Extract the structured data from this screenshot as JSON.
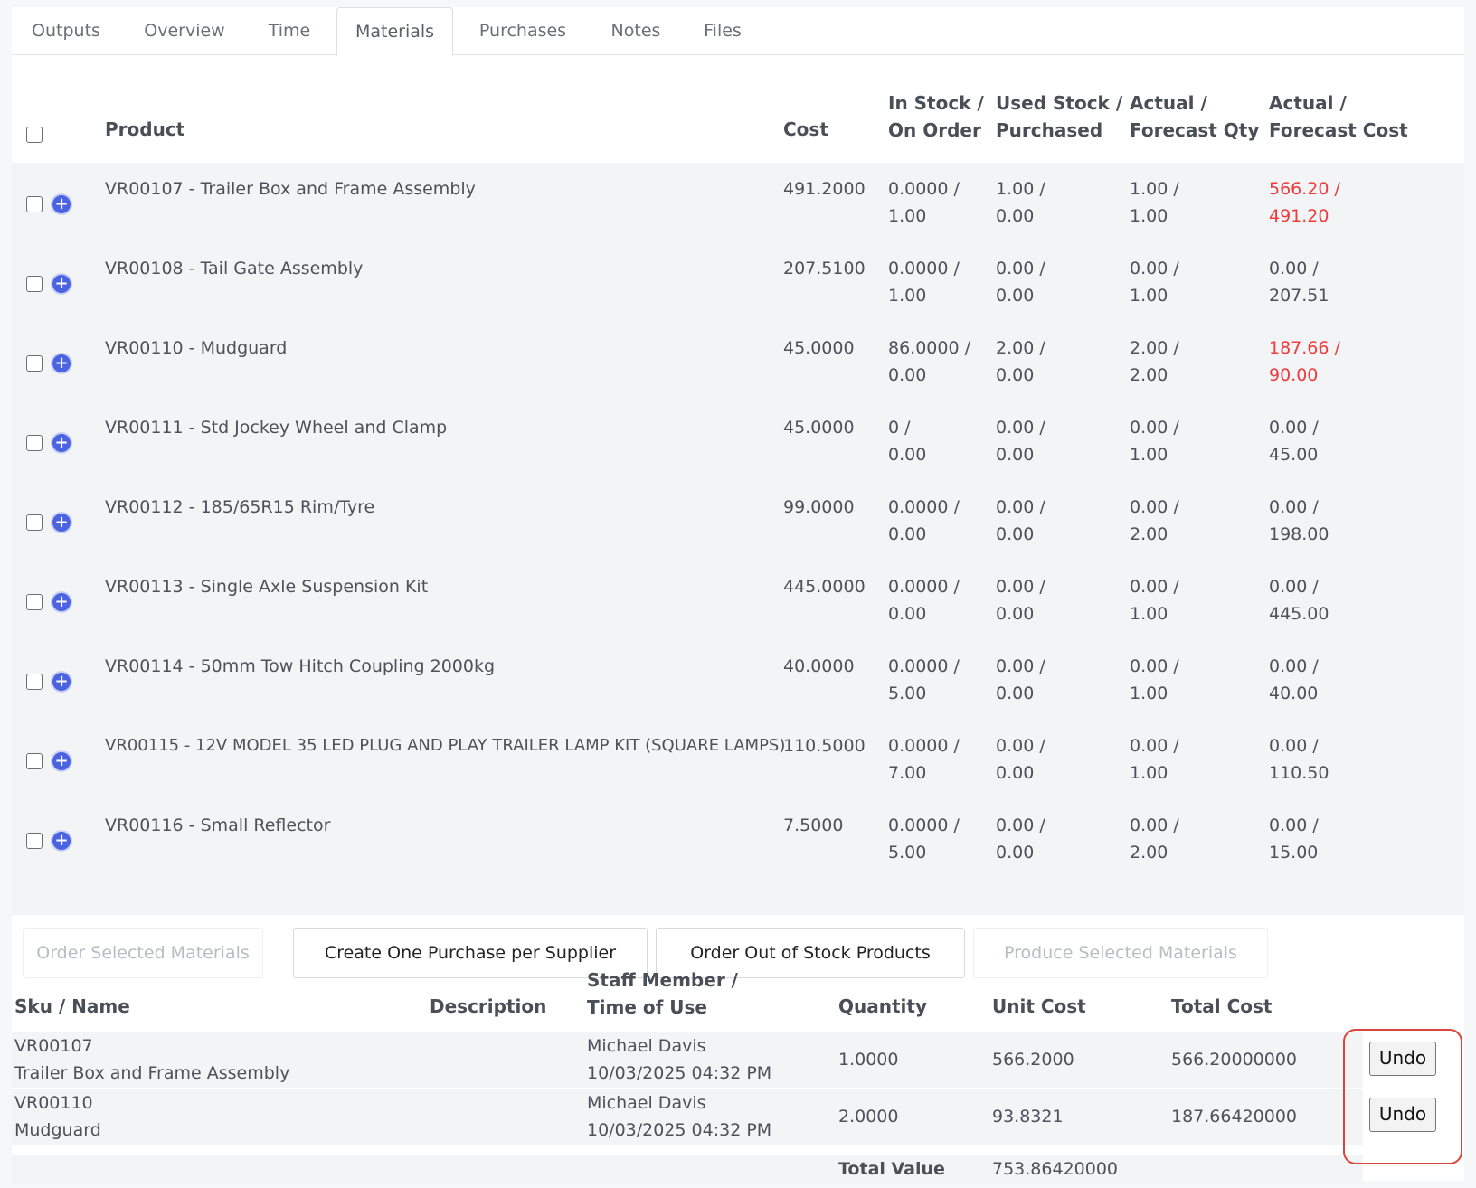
{
  "tabs": [
    {
      "label": "Outputs"
    },
    {
      "label": "Overview"
    },
    {
      "label": "Time"
    },
    {
      "label": "Materials",
      "active": true
    },
    {
      "label": "Purchases"
    },
    {
      "label": "Notes"
    },
    {
      "label": "Files"
    }
  ],
  "materials": {
    "headers": {
      "product": "Product",
      "cost": "Cost",
      "in_stock_1": "In Stock /",
      "in_stock_2": "On Order",
      "used_1": "Used Stock /",
      "used_2": "Purchased",
      "actual_qty_1": "Actual /",
      "actual_qty_2": "Forecast Qty",
      "actual_cost_1": "Actual /",
      "actual_cost_2": "Forecast Cost"
    },
    "rows": [
      {
        "product": "VR00107 - Trailer Box and Frame Assembly",
        "cost": "491.2000",
        "stock": "0.0000 /",
        "order": "1.00",
        "used": "1.00 /",
        "purchased": "0.00",
        "aqty": "1.00 /",
        "fqty": "1.00",
        "acost": "566.20 /",
        "fcost": "491.20",
        "over": true
      },
      {
        "product": "VR00108 - Tail Gate Assembly",
        "cost": "207.5100",
        "stock": "0.0000 /",
        "order": "1.00",
        "used": "0.00 /",
        "purchased": "0.00",
        "aqty": "0.00 /",
        "fqty": "1.00",
        "acost": "0.00 /",
        "fcost": "207.51",
        "over": false
      },
      {
        "product": "VR00110 - Mudguard",
        "cost": "45.0000",
        "stock": "86.0000 /",
        "order": "0.00",
        "used": "2.00 /",
        "purchased": "0.00",
        "aqty": "2.00 /",
        "fqty": "2.00",
        "acost": "187.66 /",
        "fcost": "90.00",
        "over": true
      },
      {
        "product": "VR00111 - Std Jockey Wheel and Clamp",
        "cost": "45.0000",
        "stock": "0 /",
        "order": "0.00",
        "used": "0.00 /",
        "purchased": "0.00",
        "aqty": "0.00 /",
        "fqty": "1.00",
        "acost": "0.00 /",
        "fcost": "45.00",
        "over": false
      },
      {
        "product": "VR00112 - 185/65R15 Rim/Tyre",
        "cost": "99.0000",
        "stock": "0.0000 /",
        "order": "0.00",
        "used": "0.00 /",
        "purchased": "0.00",
        "aqty": "0.00 /",
        "fqty": "2.00",
        "acost": "0.00 /",
        "fcost": "198.00",
        "over": false
      },
      {
        "product": "VR00113 - Single Axle Suspension Kit",
        "cost": "445.0000",
        "stock": "0.0000 /",
        "order": "0.00",
        "used": "0.00 /",
        "purchased": "0.00",
        "aqty": "0.00 /",
        "fqty": "1.00",
        "acost": "0.00 /",
        "fcost": "445.00",
        "over": false
      },
      {
        "product": "VR00114 - 50mm Tow Hitch Coupling 2000kg",
        "cost": "40.0000",
        "stock": "0.0000 /",
        "order": "5.00",
        "used": "0.00 /",
        "purchased": "0.00",
        "aqty": "0.00 /",
        "fqty": "1.00",
        "acost": "0.00 /",
        "fcost": "40.00",
        "over": false
      },
      {
        "product": "VR00115 - 12V MODEL 35 LED PLUG AND PLAY TRAILER LAMP KIT (SQUARE LAMPS)",
        "cost": "110.5000",
        "stock": "0.0000 /",
        "order": "7.00",
        "used": "0.00 /",
        "purchased": "0.00",
        "aqty": "0.00 /",
        "fqty": "1.00",
        "acost": "0.00 /",
        "fcost": "110.50",
        "over": false
      },
      {
        "product": "VR00116 - Small Reflector",
        "cost": "7.5000",
        "stock": "0.0000 /",
        "order": "5.00",
        "used": "0.00 /",
        "purchased": "0.00",
        "aqty": "0.00 /",
        "fqty": "2.00",
        "acost": "0.00 /",
        "fcost": "15.00",
        "over": false
      }
    ]
  },
  "actions": {
    "order_selected": "Order Selected Materials",
    "create_purchase": "Create One Purchase per Supplier",
    "order_out_of_stock": "Order Out of Stock Products",
    "produce_selected": "Produce Selected Materials"
  },
  "usage": {
    "headers": {
      "sku": "Sku / Name",
      "description": "Description",
      "staff_1": "Staff Member /",
      "staff_2": "Time of Use",
      "quantity": "Quantity",
      "unit_cost": "Unit Cost",
      "total_cost": "Total Cost"
    },
    "rows": [
      {
        "sku": "VR00107",
        "name": "Trailer Box and Frame Assembly",
        "description": "",
        "staff": "Michael Davis",
        "time": "10/03/2025 04:32 PM",
        "quantity": "1.0000",
        "unit_cost": "566.2000",
        "total_cost": "566.20000000",
        "undo": "Undo"
      },
      {
        "sku": "VR00110",
        "name": "Mudguard",
        "description": "",
        "staff": "Michael Davis",
        "time": "10/03/2025 04:32 PM",
        "quantity": "2.0000",
        "unit_cost": "93.8321",
        "total_cost": "187.66420000",
        "undo": "Undo"
      }
    ],
    "total_label": "Total Value",
    "total_value": "753.86420000"
  },
  "colors": {
    "accent": "#4b63e0",
    "over_budget": "#ee3b3b",
    "highlight": "#d9453a"
  }
}
